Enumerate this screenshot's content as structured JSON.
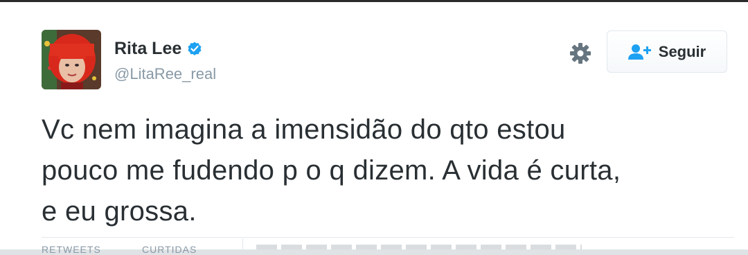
{
  "tweet": {
    "author": {
      "display_name": "Rita Lee",
      "handle": "@LitaRee_real",
      "verified": true,
      "avatar_icon": "profile-photo-red-hair"
    },
    "follow_label": "Seguir",
    "text_lines": [
      "Vc nem imagina a imensidão do qto estou",
      "pouco me fudendo p o q dizem. A vida é curta,",
      "e eu grossa."
    ],
    "stats": {
      "retweets_label": "RETWEETS",
      "likes_label": "CURTIDAS"
    }
  },
  "colors": {
    "verified_blue": "#1da1f2",
    "text": "#292f33",
    "muted": "#8899a6",
    "follow_icon_blue": "#1da1f2"
  },
  "icons": {
    "settings": "gear-icon",
    "follow": "add-user-icon",
    "verified": "verified-badge-icon"
  }
}
